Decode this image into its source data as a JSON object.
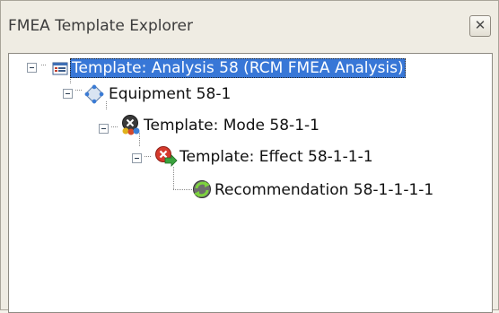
{
  "panel": {
    "title": "FMEA Template Explorer",
    "close_glyph": "✕"
  },
  "tree": {
    "nodes": [
      {
        "label": "Template: Analysis 58 (RCM FMEA Analysis)",
        "icon": "analysis-template-icon",
        "selected": true
      },
      {
        "label": "Equipment 58-1",
        "icon": "equipment-icon"
      },
      {
        "label": "Template: Mode 58-1-1",
        "icon": "failure-mode-icon"
      },
      {
        "label": "Template: Effect 58-1-1-1",
        "icon": "failure-effect-icon"
      },
      {
        "label": "Recommendation 58-1-1-1-1",
        "icon": "recommendation-icon"
      }
    ]
  },
  "colors": {
    "selection": "#3877d7",
    "panel_bg": "#efece3"
  }
}
